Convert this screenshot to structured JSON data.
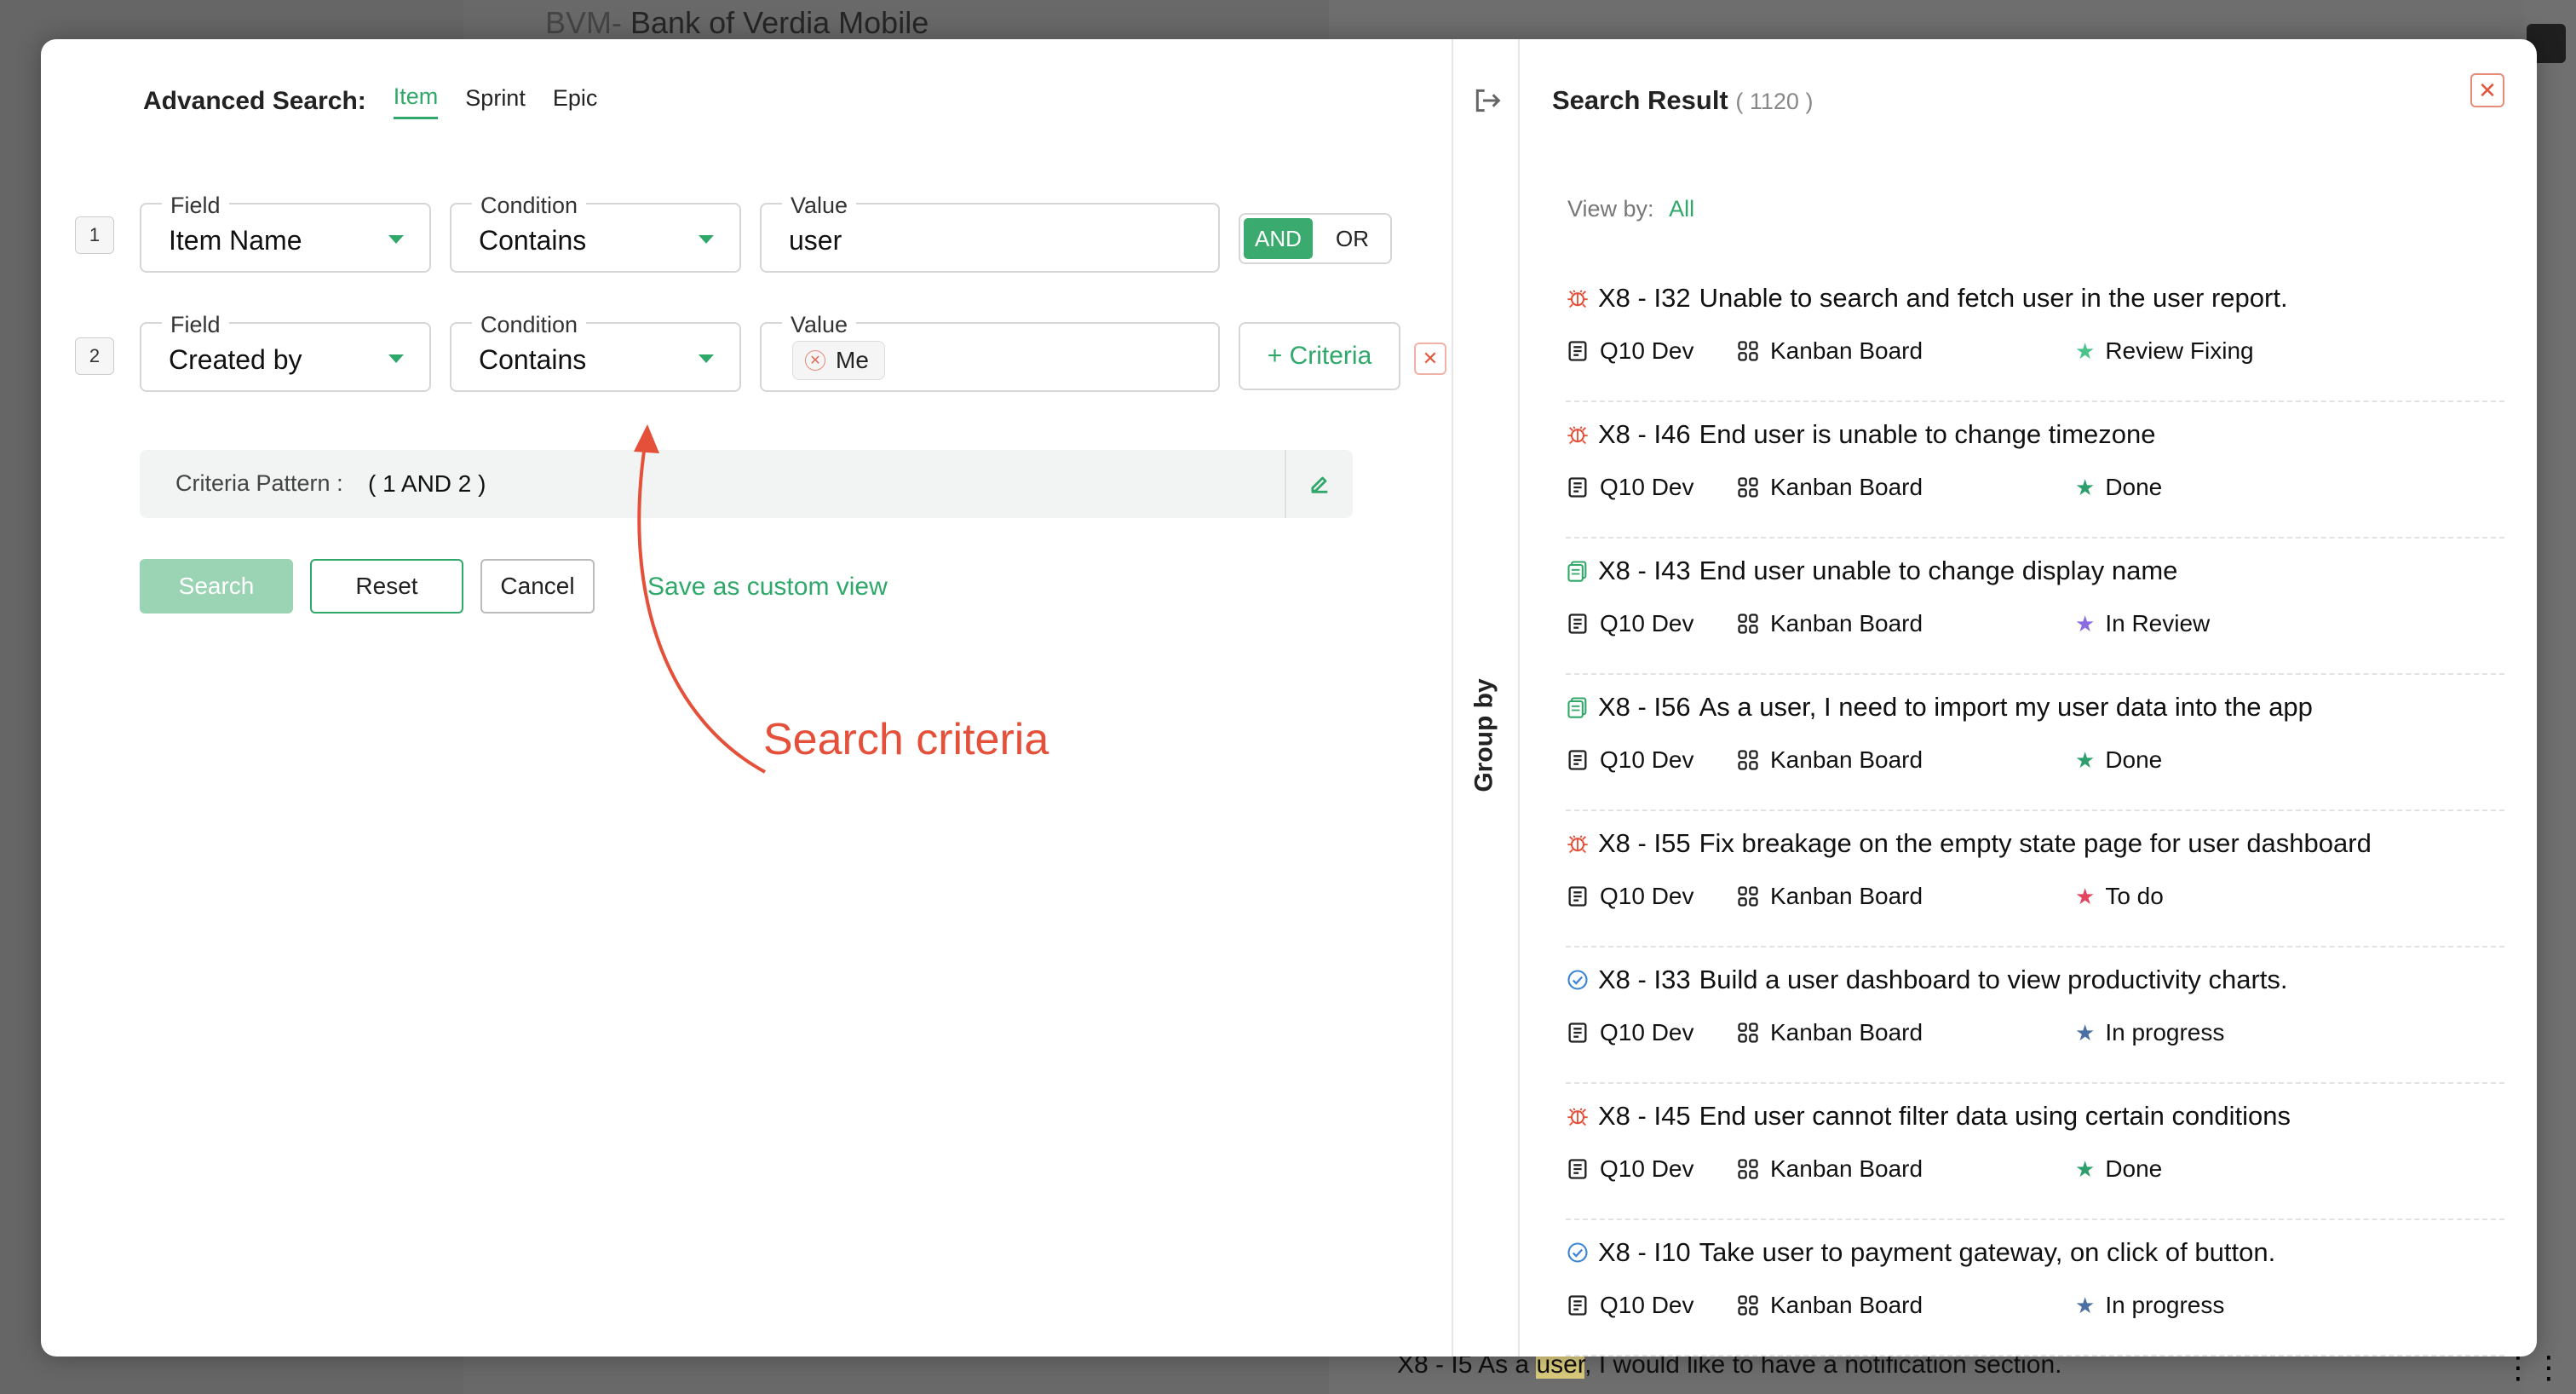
{
  "background": {
    "title_prefix": "BVM-",
    "title": "Bank of Verdia Mobile",
    "bottom_item_code": "X8 - I5",
    "bottom_item_pre": "As a ",
    "bottom_item_highlight": "user",
    "bottom_item_post": ", I would like to have a notification section."
  },
  "search": {
    "label": "Advanced Search:",
    "tabs": [
      {
        "label": "Item",
        "active": true
      },
      {
        "label": "Sprint",
        "active": false
      },
      {
        "label": "Epic",
        "active": false
      }
    ],
    "rows": [
      {
        "num": "1",
        "field_label": "Field",
        "field_value": "Item Name",
        "condition_label": "Condition",
        "condition_value": "Contains",
        "value_label": "Value",
        "value": "user"
      },
      {
        "num": "2",
        "field_label": "Field",
        "field_value": "Created by",
        "condition_label": "Condition",
        "condition_value": "Contains",
        "value_label": "Value",
        "value_chip": "Me"
      }
    ],
    "and_label": "AND",
    "or_label": "OR",
    "add_criteria": "+ Criteria",
    "pattern_label": "Criteria Pattern :",
    "pattern_value": "( 1 AND 2 )",
    "search_btn": "Search",
    "reset_btn": "Reset",
    "cancel_btn": "Cancel",
    "save_view": "Save as custom view",
    "annotation": "Search criteria",
    "group_by": "Group by"
  },
  "results": {
    "title": "Search Result",
    "count": "( 1120 )",
    "view_by_label": "View by:",
    "view_by_value": "All",
    "items": [
      {
        "type": "bug",
        "code": "X8 - I32",
        "title": "Unable to search and fetch user in the user report.",
        "sprint": "Q10 Dev",
        "board": "Kanban Board",
        "status": "Review Fixing",
        "status_color": "#4cc38a"
      },
      {
        "type": "bug",
        "code": "X8 - I46",
        "title": "End user is unable to change timezone",
        "sprint": "Q10 Dev",
        "board": "Kanban Board",
        "status": "Done",
        "status_color": "#2e9e6e"
      },
      {
        "type": "story",
        "code": "X8 - I43",
        "title": "End user unable to change display name",
        "sprint": "Q10 Dev",
        "board": "Kanban Board",
        "status": "In Review",
        "status_color": "#8a6de0"
      },
      {
        "type": "story",
        "code": "X8 - I56",
        "title": "As a user, I need to import my user data into the app",
        "sprint": "Q10 Dev",
        "board": "Kanban Board",
        "status": "Done",
        "status_color": "#2e9e6e"
      },
      {
        "type": "bug",
        "code": "X8 - I55",
        "title": "Fix breakage on the empty state page for user dashboard",
        "sprint": "Q10 Dev",
        "board": "Kanban Board",
        "status": "To do",
        "status_color": "#e2455e"
      },
      {
        "type": "task",
        "code": "X8 - I33",
        "title": "Build a user dashboard to view productivity charts.",
        "sprint": "Q10 Dev",
        "board": "Kanban Board",
        "status": "In progress",
        "status_color": "#4a6fa5"
      },
      {
        "type": "bug",
        "code": "X8 - I45",
        "title": "End user cannot filter data using certain conditions",
        "sprint": "Q10 Dev",
        "board": "Kanban Board",
        "status": "Done",
        "status_color": "#2e9e6e"
      },
      {
        "type": "task",
        "code": "X8 - I10",
        "title": "Take user to payment gateway, on click of button.",
        "sprint": "Q10 Dev",
        "board": "Kanban Board",
        "status": "In progress",
        "status_color": "#4a6fa5"
      }
    ]
  }
}
